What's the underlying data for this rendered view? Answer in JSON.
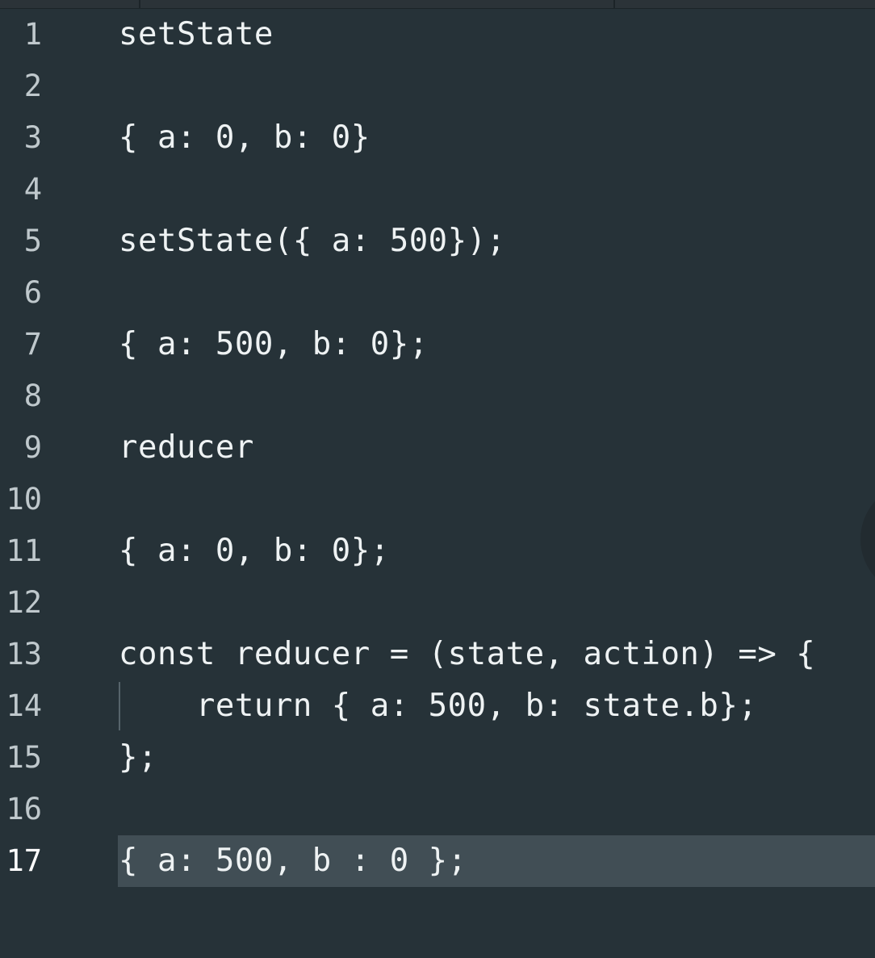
{
  "editor": {
    "active_line": 17,
    "lines": [
      {
        "num": "1",
        "text": "setState"
      },
      {
        "num": "2",
        "text": ""
      },
      {
        "num": "3",
        "text": "{ a: 0, b: 0}"
      },
      {
        "num": "4",
        "text": ""
      },
      {
        "num": "5",
        "text": "setState({ a: 500});"
      },
      {
        "num": "6",
        "text": ""
      },
      {
        "num": "7",
        "text": "{ a: 500, b: 0};"
      },
      {
        "num": "8",
        "text": ""
      },
      {
        "num": "9",
        "text": "reducer"
      },
      {
        "num": "10",
        "text": ""
      },
      {
        "num": "11",
        "text": "{ a: 0, b: 0};"
      },
      {
        "num": "12",
        "text": ""
      },
      {
        "num": "13",
        "text": "const reducer = (state, action) => {"
      },
      {
        "num": "14",
        "text": "    return { a: 500, b: state.b};"
      },
      {
        "num": "15",
        "text": "};"
      },
      {
        "num": "16",
        "text": ""
      },
      {
        "num": "17",
        "text": "{ a: 500, b : 0 };"
      }
    ]
  },
  "colors": {
    "background": "#263238",
    "text": "#eef2f3",
    "line_number": "#bfc8cc",
    "active_line_bg": "#414e55"
  }
}
